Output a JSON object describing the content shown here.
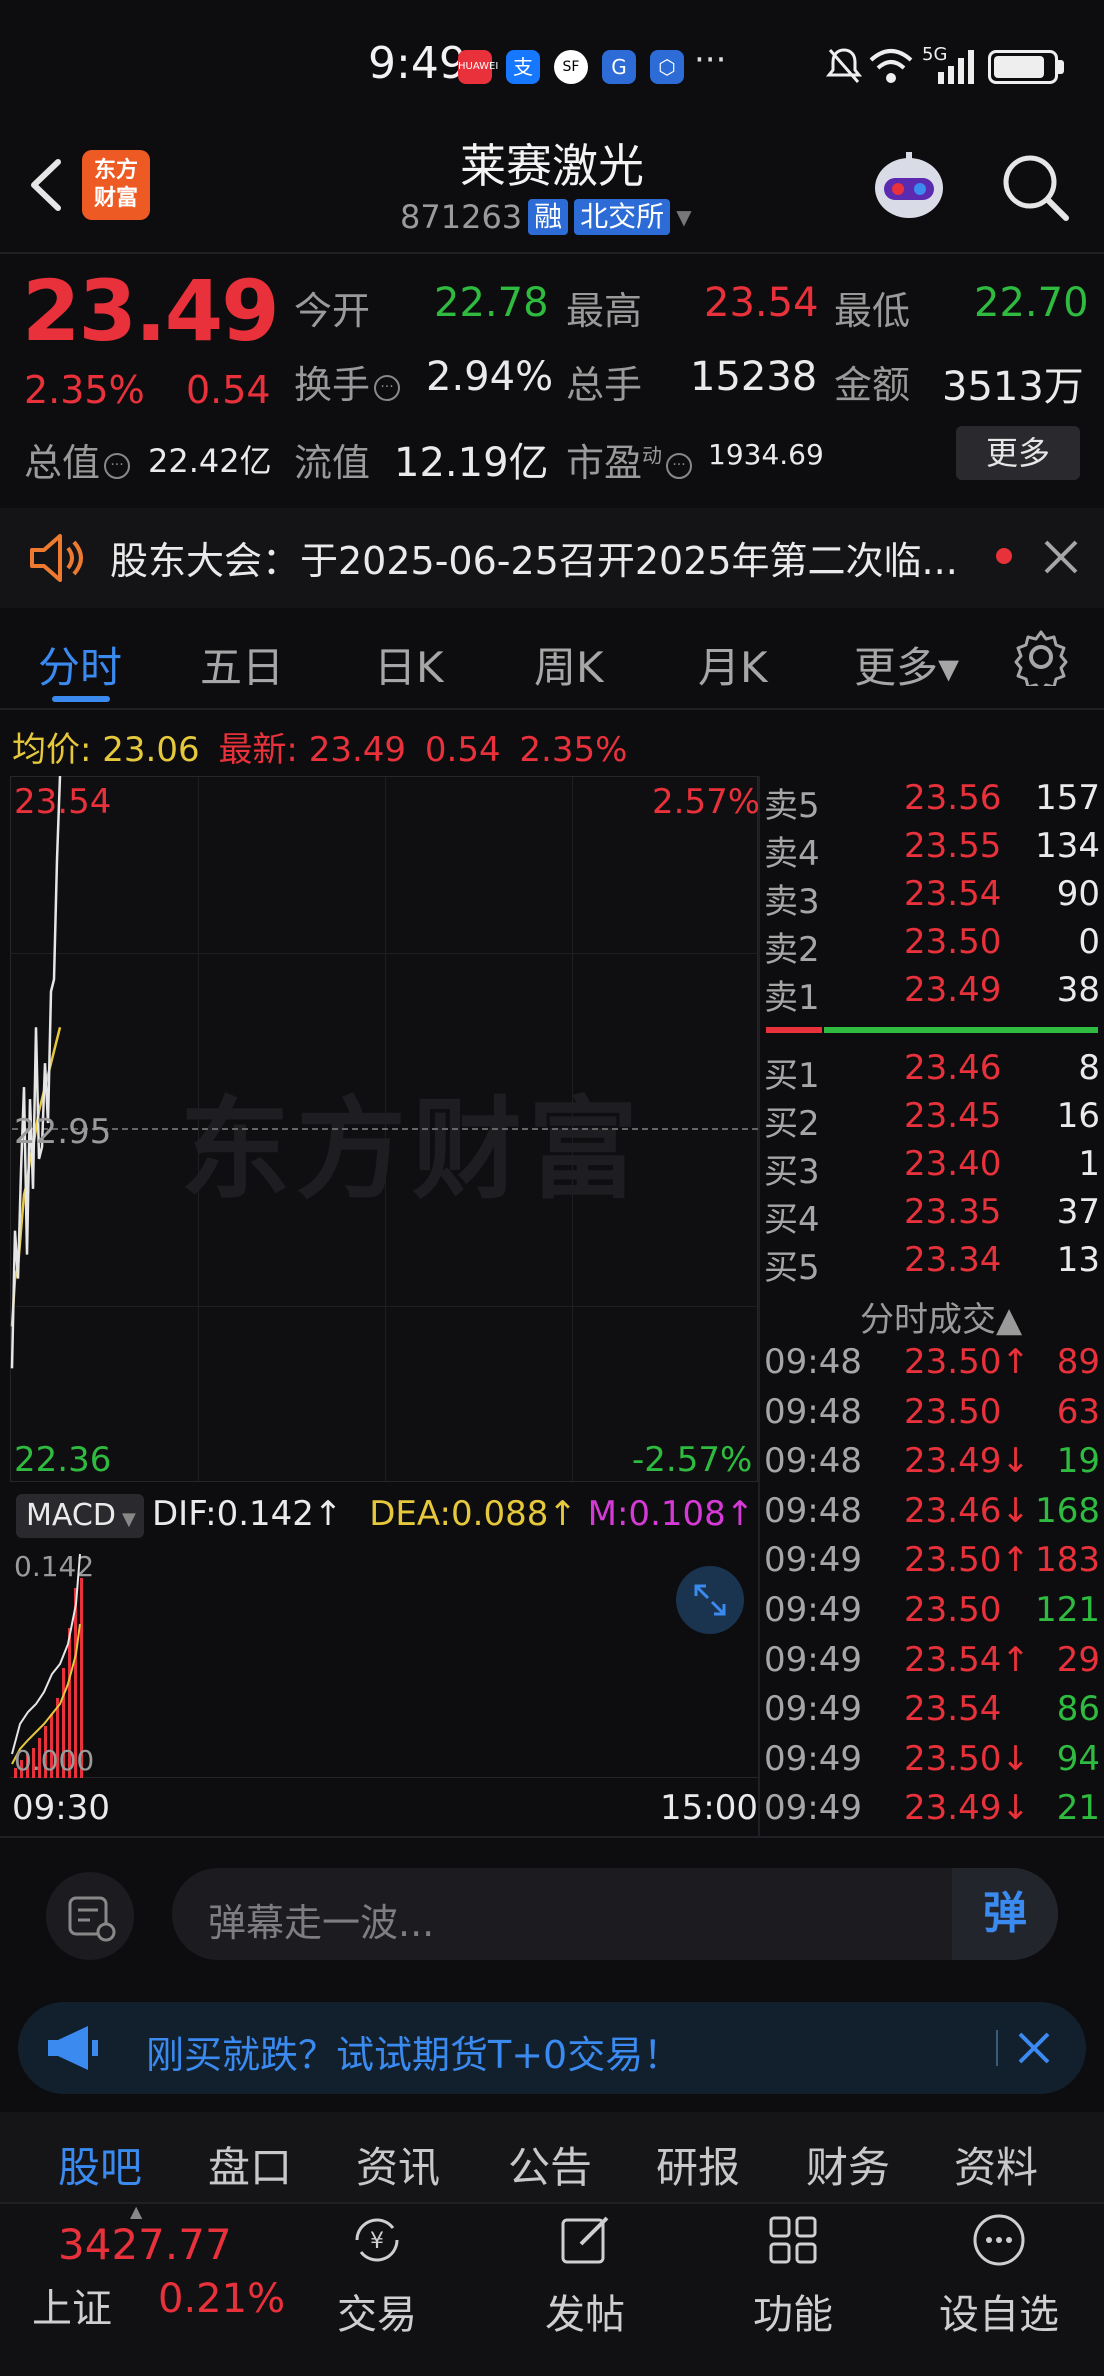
{
  "status_bar": {
    "time": "9:49",
    "apps": [
      "HUAWEI",
      "支",
      "SF",
      "G",
      "⬡"
    ],
    "more": "···",
    "network": "5G"
  },
  "header": {
    "title": "莱赛激光",
    "code": "871263",
    "tag_margin": "融",
    "tag_exchange": "北交所",
    "logo_line1": "东方",
    "logo_line2": "财富"
  },
  "quote": {
    "price": "23.49",
    "change_pct": "2.35%",
    "change_amt": "0.54",
    "open_label": "今开",
    "open": "22.78",
    "high_label": "最高",
    "high": "23.54",
    "low_label": "最低",
    "low": "22.70",
    "turnover_label": "换手",
    "turnover": "2.94%",
    "volume_label": "总手",
    "volume": "15238",
    "amount_label": "金额",
    "amount": "3513万",
    "mktcap_label": "总值",
    "mktcap": "22.42亿",
    "float_label": "流值",
    "float_cap": "12.19亿",
    "pe_label": "市盈",
    "pe_sup": "动",
    "pe": "1934.69",
    "more_btn": "更多"
  },
  "notice": {
    "text": "股东大会：于2025-06-25召开2025年第二次临..."
  },
  "tabs": [
    "分时",
    "五日",
    "日K",
    "周K",
    "月K",
    "更多▾"
  ],
  "active_tab": 0,
  "avg_row": {
    "avg_label": "均价:",
    "avg": "23.06",
    "last_label": "最新:",
    "last": "23.49",
    "chg": "0.54",
    "pct": "2.35%"
  },
  "chart": {
    "y_top": "23.54",
    "y_top_pct": "2.57%",
    "y_mid": "22.95",
    "y_bot": "22.36",
    "y_bot_pct": "-2.57%",
    "watermark": "东方财富",
    "x_start": "09:30",
    "x_end": "15:00",
    "price_series": [
      22.55,
      22.78,
      22.7,
      22.88,
      23.02,
      22.74,
      23.0,
      22.85,
      23.12,
      22.9,
      22.92,
      23.06,
      22.96,
      23.18,
      23.2,
      23.4,
      23.54
    ],
    "avg_series": [
      22.62,
      22.7,
      22.72,
      22.78,
      22.84,
      22.86,
      22.9,
      22.92,
      22.95,
      22.98,
      23.0,
      23.02,
      23.04,
      23.06,
      23.08,
      23.1,
      23.12
    ],
    "colors": {
      "price": "#e6e6e6",
      "avg": "#e6c83c",
      "up": "#e8313a",
      "down": "#2fbb3f"
    }
  },
  "macd": {
    "label": "MACD",
    "dif": "DIF:0.142↑",
    "dea": "DEA:0.088↑",
    "m": "M:0.108↑",
    "y_top": "0.142",
    "y_bot": "0.000"
  },
  "orderbook": {
    "asks": [
      {
        "label": "卖5",
        "price": "23.56",
        "vol": "157"
      },
      {
        "label": "卖4",
        "price": "23.55",
        "vol": "134"
      },
      {
        "label": "卖3",
        "price": "23.54",
        "vol": "90"
      },
      {
        "label": "卖2",
        "price": "23.50",
        "vol": "0"
      },
      {
        "label": "卖1",
        "price": "23.49",
        "vol": "38"
      }
    ],
    "bids": [
      {
        "label": "买1",
        "price": "23.46",
        "vol": "8"
      },
      {
        "label": "买2",
        "price": "23.45",
        "vol": "16"
      },
      {
        "label": "买3",
        "price": "23.40",
        "vol": "1"
      },
      {
        "label": "买4",
        "price": "23.35",
        "vol": "37"
      },
      {
        "label": "买5",
        "price": "23.34",
        "vol": "13"
      }
    ],
    "ticks_title": "分时成交▲",
    "ticks": [
      {
        "time": "09:48",
        "price": "23.50↑",
        "vol": "89",
        "pc": "red",
        "vc": "red"
      },
      {
        "time": "09:48",
        "price": "23.50",
        "vol": "63",
        "pc": "red",
        "vc": "red"
      },
      {
        "time": "09:48",
        "price": "23.49↓",
        "vol": "19",
        "pc": "red",
        "vc": "green"
      },
      {
        "time": "09:48",
        "price": "23.46↓",
        "vol": "168",
        "pc": "red",
        "vc": "green"
      },
      {
        "time": "09:49",
        "price": "23.50↑",
        "vol": "183",
        "pc": "red",
        "vc": "red"
      },
      {
        "time": "09:49",
        "price": "23.50",
        "vol": "121",
        "pc": "red",
        "vc": "green"
      },
      {
        "time": "09:49",
        "price": "23.54↑",
        "vol": "29",
        "pc": "red",
        "vc": "red"
      },
      {
        "time": "09:49",
        "price": "23.54",
        "vol": "86",
        "pc": "red",
        "vc": "green"
      },
      {
        "time": "09:49",
        "price": "23.50↓",
        "vol": "94",
        "pc": "red",
        "vc": "green"
      },
      {
        "time": "09:49",
        "price": "23.49↓",
        "vol": "21",
        "pc": "red",
        "vc": "green"
      }
    ]
  },
  "comment": {
    "placeholder": "弹幕走一波...",
    "danmu_btn": "弹"
  },
  "promo": {
    "text": "刚买就跌？试试期货T+0交易！"
  },
  "subnav": [
    "股吧",
    "盘口",
    "资讯",
    "公告",
    "研报",
    "财务",
    "资料"
  ],
  "bottom_nav": {
    "index_value": "3427.77",
    "index_name": "上证",
    "index_pct": "0.21%",
    "items": [
      {
        "label": "交易",
        "icon": "yuan-cycle-icon"
      },
      {
        "label": "发帖",
        "icon": "edit-icon"
      },
      {
        "label": "功能",
        "icon": "grid-icon"
      },
      {
        "label": "设自选",
        "icon": "more-circle-icon"
      }
    ]
  }
}
